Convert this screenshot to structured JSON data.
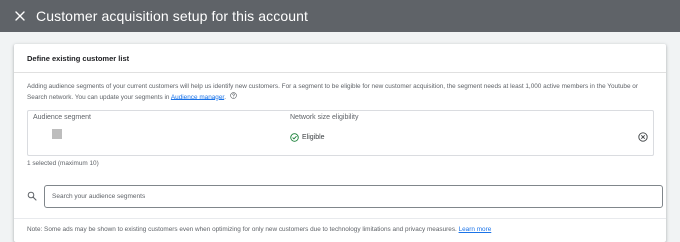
{
  "topbar": {
    "title": "Customer acquisition setup for this account",
    "close_icon": "close-icon"
  },
  "section": {
    "title": "Define existing customer list",
    "description": "Adding audience segments of your current customers will help us identify new customers. For a segment to be eligible for new customer acquisition, the segment needs at least 1,000 active members in the Youtube or Search network. You can update your segments in ",
    "manager_link": "Audience manager",
    "description_end": "."
  },
  "table": {
    "col_segment": "Audience segment",
    "col_eligibility": "Network size eligibility",
    "rows": [
      {
        "status": "Eligible",
        "status_color": "#188038"
      }
    ]
  },
  "selected_count": "1 selected (maximum 10)",
  "search": {
    "placeholder": "Search your audience segments"
  },
  "note": {
    "text": "Note: Some ads may be shown to existing customers even when optimizing for only new customers due to technology limitations and privacy measures. ",
    "link": "Learn more"
  },
  "colors": {
    "topbar_bg": "#5f6368",
    "link": "#1a73e8",
    "eligible": "#188038"
  }
}
